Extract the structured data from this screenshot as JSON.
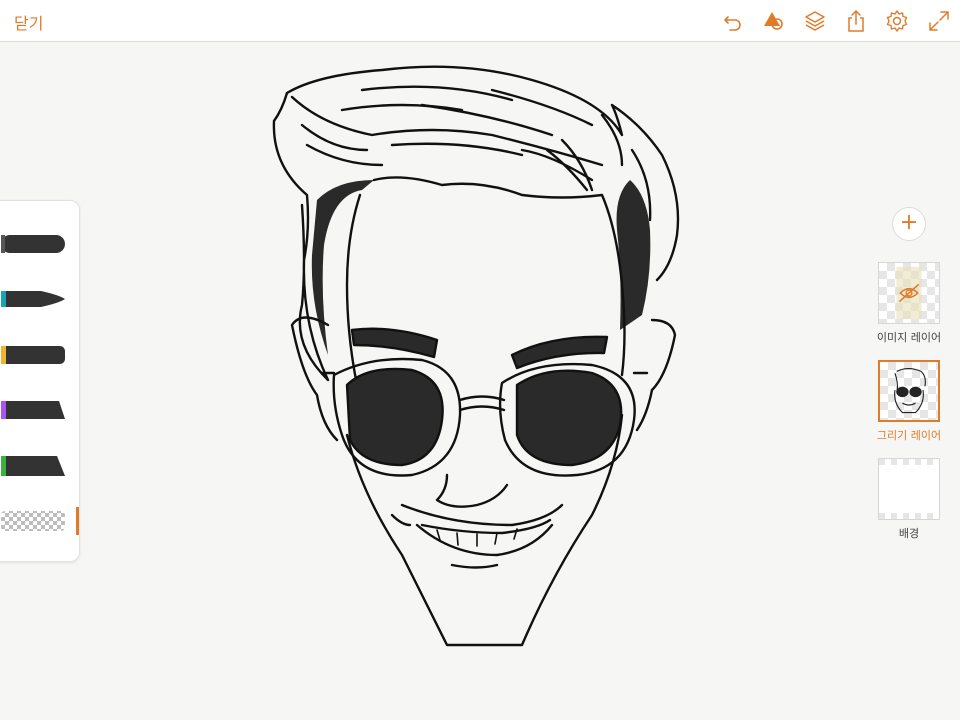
{
  "toolbar": {
    "close_label": "닫기",
    "icons": [
      "undo-icon",
      "shapes-icon",
      "layers-icon",
      "share-icon",
      "settings-icon",
      "fullscreen-icon"
    ]
  },
  "tools": [
    {
      "name": "pencil",
      "color": "#333333"
    },
    {
      "name": "pen",
      "color": "#1aa3b5"
    },
    {
      "name": "marker",
      "color": "#f2b233"
    },
    {
      "name": "brush",
      "color": "#a855f7"
    },
    {
      "name": "airbrush",
      "color": "#3cb043"
    },
    {
      "name": "eraser",
      "color": "#bdbdbd"
    }
  ],
  "layers": [
    {
      "label": "이미지 레이어",
      "hidden": true
    },
    {
      "label": "그리기 레이어",
      "selected": true
    },
    {
      "label": "배경"
    }
  ],
  "colors": {
    "accent": "#e07b2a"
  }
}
